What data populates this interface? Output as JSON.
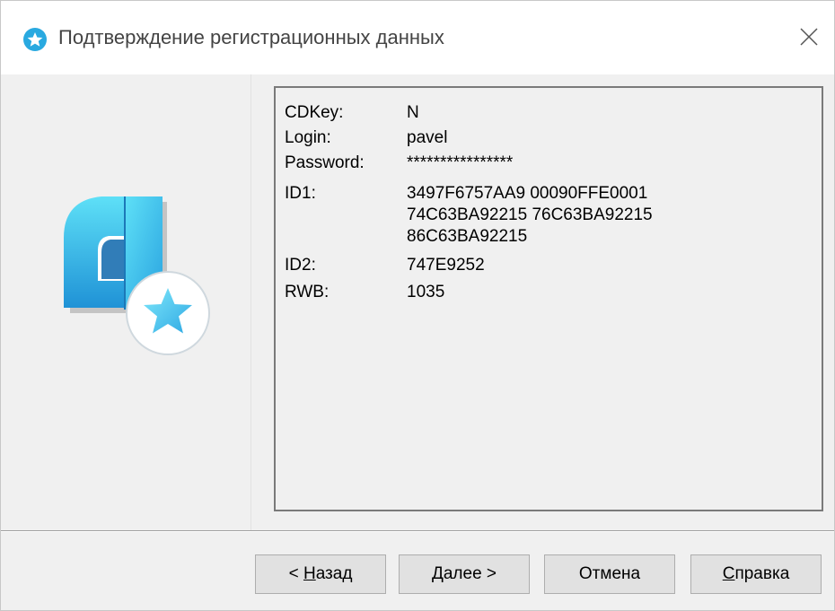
{
  "window": {
    "title": "Подтверждение регистрационных данных"
  },
  "info": {
    "rows": [
      {
        "label": "CDKey:",
        "value": "N"
      },
      {
        "label": "Login:",
        "value": "pavel"
      },
      {
        "label": "Password:",
        "value": "****************"
      },
      {
        "label": "ID1:",
        "value": "3497F6757AA9 00090FFE0001\n74C63BA92215 76C63BA92215\n86C63BA92215"
      },
      {
        "label": "ID2:",
        "value": "747E9252"
      },
      {
        "label": "RWB:",
        "value": "1035"
      }
    ]
  },
  "buttons": {
    "back": {
      "prefix": "< ",
      "mnemonic": "Н",
      "rest": "азад"
    },
    "next": {
      "mnemonic": "Д",
      "rest": "алее >"
    },
    "cancel": {
      "label": "Отмена"
    },
    "help": {
      "mnemonic": "С",
      "rest": "правка"
    }
  },
  "colors": {
    "accent": "#29a9e0",
    "logo_light": "#4fd6f5",
    "logo_dark": "#1a8fd1"
  },
  "icons": {
    "title": "app-star-badge-icon",
    "close": "close-icon",
    "logo": "product-logo-icon"
  }
}
